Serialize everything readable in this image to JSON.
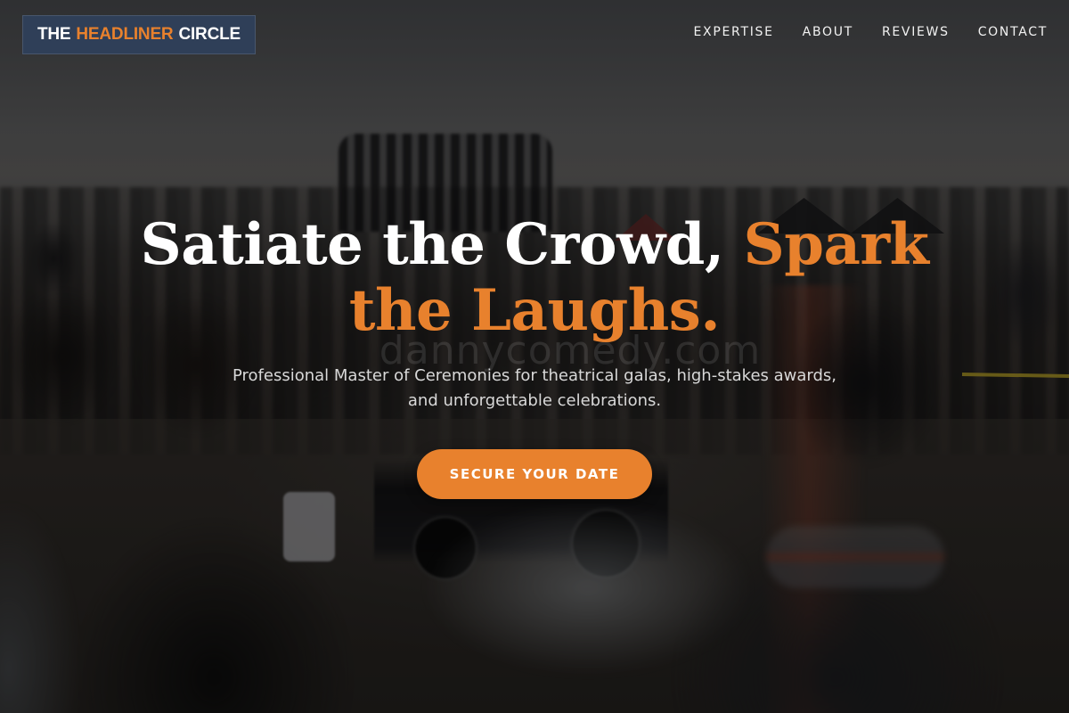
{
  "nav": {
    "logo": {
      "part1": "THE",
      "part2": "HEADLINER",
      "part3": "CIRCLE"
    },
    "links": [
      "EXPERTISE",
      "ABOUT",
      "REVIEWS",
      "CONTACT"
    ]
  },
  "hero": {
    "headline_white": "Satiate the Crowd, ",
    "headline_accent": "Spark the Laughs.",
    "subtitle": "Professional Master of Ceremonies for theatrical galas, high-stakes awards, and unforgettable celebrations.",
    "cta_label": "SECURE YOUR DATE",
    "watermark": "dannycomedy.com"
  },
  "colors": {
    "accent": "#e8812d",
    "logo_bg": "#2f405b",
    "text": "#ffffff"
  }
}
